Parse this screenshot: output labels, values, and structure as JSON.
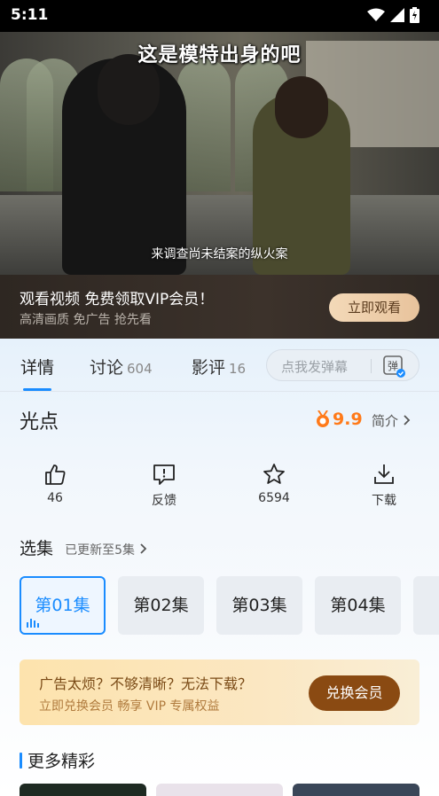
{
  "status_bar": {
    "time": "5:11"
  },
  "video": {
    "caption_top": "这是模特出身的吧",
    "caption_bottom": "来调查尚未结案的纵火案"
  },
  "vip_banner": {
    "title": "观看视频 免费领取VIP会员！",
    "subtitle": "高清画质 免广告 抢先看",
    "button": "立即观看"
  },
  "tabs": [
    {
      "label": "详情",
      "count": ""
    },
    {
      "label": "讨论",
      "count": "604"
    },
    {
      "label": "影评",
      "count": "16"
    }
  ],
  "danmaku": {
    "placeholder": "点我发弹幕",
    "icon_text": "弹"
  },
  "show": {
    "title": "光点",
    "rating": "9.9",
    "intro_label": "简介"
  },
  "actions": [
    {
      "icon": "thumbs-up-icon",
      "label": "46"
    },
    {
      "icon": "feedback-icon",
      "label": "反馈"
    },
    {
      "icon": "star-icon",
      "label": "6594"
    },
    {
      "icon": "download-icon",
      "label": "下载"
    }
  ],
  "episodes": {
    "header": "选集",
    "update_text": "已更新至5集",
    "items": [
      "第01集",
      "第02集",
      "第03集",
      "第04集"
    ]
  },
  "promo": {
    "line1": "广告太烦？不够清晰？无法下载？",
    "line2": "立即兑换会员 畅享 VIP 专属权益",
    "button": "兑换会员"
  },
  "more": {
    "header": "更多精彩"
  },
  "colors": {
    "accent": "#1a8cff",
    "rating": "#ff7a1a",
    "promo_button": "#8a4a12"
  }
}
